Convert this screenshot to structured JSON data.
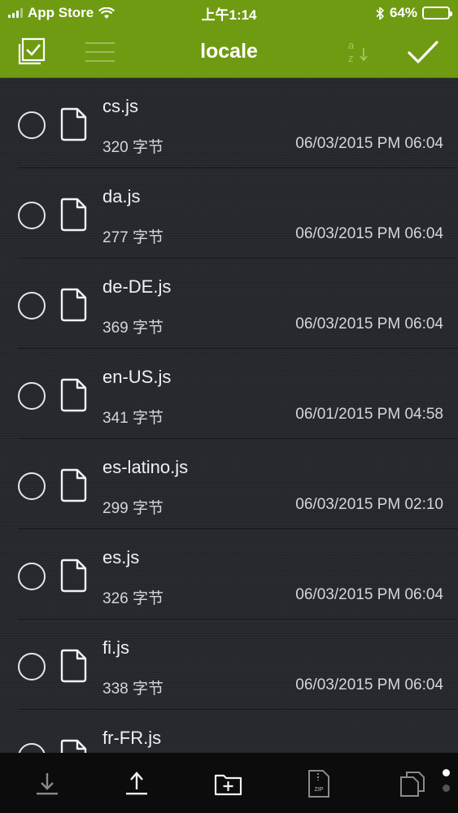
{
  "statusbar": {
    "carrier": "App Store",
    "time": "上午1:14",
    "battery": "64%",
    "battery_level": 0.64
  },
  "navbar": {
    "title": "locale",
    "icons": [
      "select-all-icon",
      "list-menu-icon",
      "sort-az-icon",
      "checkmark-icon"
    ]
  },
  "files": [
    {
      "name": "cs.js",
      "size": "320 字节",
      "date": "06/03/2015 PM 06:04"
    },
    {
      "name": "da.js",
      "size": "277 字节",
      "date": "06/03/2015 PM 06:04"
    },
    {
      "name": "de-DE.js",
      "size": "369 字节",
      "date": "06/03/2015 PM 06:04"
    },
    {
      "name": "en-US.js",
      "size": "341 字节",
      "date": "06/01/2015 PM 04:58"
    },
    {
      "name": "es-latino.js",
      "size": "299 字节",
      "date": "06/03/2015 PM 02:10"
    },
    {
      "name": "es.js",
      "size": "326 字节",
      "date": "06/03/2015 PM 06:04"
    },
    {
      "name": "fi.js",
      "size": "338 字节",
      "date": "06/03/2015 PM 06:04"
    },
    {
      "name": "fr-FR.js",
      "size": "",
      "date": ""
    }
  ],
  "toolbar": {
    "icons": [
      "download-icon",
      "upload-icon",
      "new-folder-icon",
      "zip-icon",
      "copy-icon"
    ],
    "zip_label": "ZIP",
    "page": 1,
    "page_count": 2
  },
  "colors": {
    "accent": "#6f9b12",
    "background": "#26292e",
    "toolbar": "#0c0c0d"
  }
}
